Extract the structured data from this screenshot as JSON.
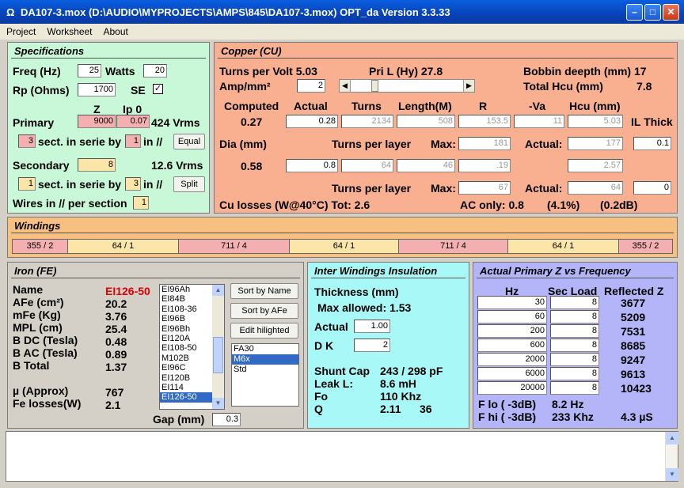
{
  "window": {
    "title": "DA107-3.mox  (D:\\AUDIO\\MYPROJECTS\\AMPS\\845\\DA107-3.mox)  OPT_da Version 3.3.33"
  },
  "menu": [
    "Project",
    "Worksheet",
    "About"
  ],
  "spec": {
    "title": "Specifications",
    "freq_label": "Freq (Hz)",
    "freq": "25",
    "watts_label": "Watts",
    "watts": "20",
    "rp_label": "Rp (Ohms)",
    "rp": "1700",
    "se_label": "SE",
    "z_head": "Z",
    "ip0_head": "Ip 0",
    "primary_label": "Primary",
    "primary_z": "9000",
    "primary_ip0": "0.07",
    "primary_vrms": "424 Vrms",
    "prim_sect": "3",
    "sect_text": "sect. in serie by",
    "prim_par": "1",
    "in_par": "in //",
    "equal_btn": "Equal",
    "secondary_label": "Secondary",
    "secondary_z": "8",
    "secondary_vrms": "12.6 Vrms",
    "sec_sect": "1",
    "sec_par": "3",
    "split_btn": "Split",
    "wires_label": "Wires in // per section",
    "wires": "1"
  },
  "copper": {
    "title": "Copper (CU)",
    "tpv": "Turns per Volt 5.03",
    "pril": "Pri L (Hy) 27.8",
    "bobbin": "Bobbin deepth (mm) 17",
    "amp_label": "Amp/mm²",
    "amp": "2",
    "total_hcu_label": "Total Hcu (mm)",
    "total_hcu": "7.8",
    "h_computed": "Computed",
    "h_actual": "Actual",
    "h_turns": "Turns",
    "h_length": "Length(M)",
    "h_r": "R",
    "h_va": "-Va",
    "h_hcu": "Hcu (mm)",
    "il_thick": "IL Thick",
    "computed1": "0.27",
    "actual1": "0.28",
    "turns1": "2134",
    "length1": "508",
    "r1": "153.5",
    "va1": "11",
    "hcu1": "5.03",
    "dia_label": "Dia (mm)",
    "tpl1": "Turns per layer",
    "max1_label": "Max:",
    "max1": "181",
    "act1_label": "Actual:",
    "act1": "177",
    "il1": "0.1",
    "computed2": "0.58",
    "actual2": "0.8",
    "turns2": "64",
    "length2": "46",
    "r2": ".19",
    "hcu2": "2.57",
    "tpl2": "Turns per layer",
    "max2_label": "Max:",
    "max2": "67",
    "act2_label": "Actual:",
    "act2": "64",
    "il2": "0",
    "losses": "Cu losses (W@40°C) Tot: 2.6",
    "ac_only": "AC only: 0.8",
    "pct": "(4.1%)",
    "db": "(0.2dB)"
  },
  "windings": {
    "title": "Windings",
    "segments": [
      "355 / 2",
      "64 / 1",
      "711 / 4",
      "64 / 1",
      "711 / 4",
      "64 / 1",
      "355 / 2"
    ]
  },
  "iron": {
    "title": "Iron (FE)",
    "labels": [
      "Name",
      "AFe (cm²)",
      "mFe (Kg)",
      "MPL (cm)",
      "B DC (Tesla)",
      "B AC (Tesla)",
      "B Total"
    ],
    "values": [
      "EI126-50",
      "20.2",
      "3.76",
      "25.4",
      "0.48",
      "0.89",
      "1.37"
    ],
    "mu_label": "µ (Approx)",
    "mu": "767",
    "fe_label": "Fe losses(W)",
    "fe": "2.1",
    "cores": [
      "EI96Ah",
      "EI84B",
      "EI108-36",
      "EI96B",
      "EI96Bh",
      "EI120A",
      "EI108-50",
      "M102B",
      "EI96C",
      "EI120B",
      "EI114",
      "EI126-50"
    ],
    "sort_name": "Sort by Name",
    "sort_afe": "Sort by AFe",
    "edit": "Edit hilighted",
    "materials": [
      "FA30",
      "M6x",
      "Std"
    ],
    "gap_label": "Gap (mm)",
    "gap": "0.3"
  },
  "insul": {
    "title": "Inter Windings Insulation",
    "thick_label": "Thickness (mm)",
    "max_allowed": "Max allowed: 1.53",
    "actual_label": "Actual",
    "actual": "1.00",
    "dk_label": "D K",
    "dk": "2",
    "shunt_label": "Shunt Cap",
    "shunt": "243 / 298 pF",
    "leak_label": "Leak L:",
    "leak": "8.6 mH",
    "fo_label": "Fo",
    "fo": "110 Khz",
    "q_label": "Q",
    "q": "2.11",
    "q2": "36"
  },
  "freqz": {
    "title": "Actual Primary Z vs Frequency",
    "h_hz": "Hz",
    "h_sec": "Sec Load",
    "h_ref": "Reflected Z",
    "hz": [
      "30",
      "60",
      "200",
      "600",
      "2000",
      "6000",
      "20000"
    ],
    "load": [
      "8",
      "8",
      "8",
      "8",
      "8",
      "8",
      "8"
    ],
    "ref": [
      "3677",
      "5209",
      "7531",
      "8685",
      "9247",
      "9613",
      "10423"
    ],
    "flo_label": "F lo ( -3dB)",
    "flo": "8.2 Hz",
    "fhi_label": "F hi ( -3dB)",
    "fhi": "233 Khz",
    "rise": "4.3 µS"
  }
}
